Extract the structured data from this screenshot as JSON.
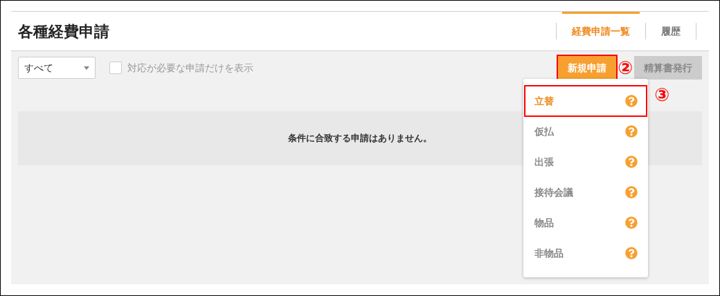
{
  "page": {
    "title": "各種経費申請"
  },
  "tabs": [
    {
      "label": "経費申請一覧",
      "selected": true
    },
    {
      "label": "履歴",
      "selected": false
    }
  ],
  "filter": {
    "value": "すべて"
  },
  "checkbox": {
    "label": "対応が必要な申請だけを表示",
    "checked": false
  },
  "buttons": [
    {
      "label": "新規申請",
      "kind": "primary",
      "highlighted": true,
      "annotation": "②"
    },
    {
      "label": "精算書発行",
      "kind": "secondary",
      "highlighted": false
    }
  ],
  "empty_message": "条件に合致する申請はありません。",
  "menu": {
    "annotation": "③",
    "items": [
      {
        "label": "立替",
        "selected": true
      },
      {
        "label": "仮払",
        "selected": false
      },
      {
        "label": "出張",
        "selected": false
      },
      {
        "label": "接待会議",
        "selected": false
      },
      {
        "label": "物品",
        "selected": false
      },
      {
        "label": "非物品",
        "selected": false
      }
    ]
  }
}
